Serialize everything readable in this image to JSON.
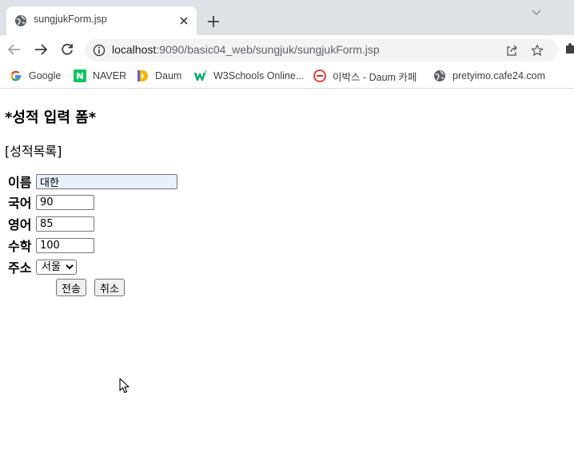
{
  "browser": {
    "tab": {
      "title": "sungjukForm.jsp",
      "favicon": "globe-icon",
      "close_icon": "close-icon"
    },
    "new_tab_icon": "plus-icon",
    "tab_search_icon": "chevron-down-icon",
    "toolbar": {
      "back_icon": "back-arrow-icon",
      "forward_icon": "forward-arrow-icon",
      "reload_icon": "reload-icon",
      "url_host": "localhost",
      "url_rest": ":9090/basic04_web/sungjuk/sungjukForm.jsp",
      "share_icon": "share-icon",
      "star_icon": "star-icon",
      "extensions_icon": "puzzle-icon"
    },
    "bookmarks": [
      {
        "label": "Google",
        "icon": "google-icon",
        "color": "#4285f4"
      },
      {
        "label": "NAVER",
        "icon": "naver-icon",
        "color": "#03c75a"
      },
      {
        "label": "Daum",
        "icon": "daum-icon",
        "color": "#f7b500"
      },
      {
        "label": "W3Schools Online...",
        "icon": "w3schools-icon",
        "color": "#04aa6d"
      },
      {
        "label": "이박스 - Daum 카페",
        "icon": "daum-cafe-icon",
        "color": "#e0322f"
      },
      {
        "label": "pretyimo.cafe24.com",
        "icon": "globe-icon",
        "color": "#5f6368"
      }
    ]
  },
  "page": {
    "title": "*성적 입력 폼*",
    "list_link": "[성적목록]",
    "form": {
      "name": {
        "label": "이름",
        "value": "대한"
      },
      "kor": {
        "label": "국어",
        "value": "90"
      },
      "eng": {
        "label": "영어",
        "value": "85"
      },
      "mat": {
        "label": "수학",
        "value": "100"
      },
      "addr": {
        "label": "주소",
        "selected": "서울"
      },
      "submit_label": "전송",
      "reset_label": "취소"
    }
  }
}
